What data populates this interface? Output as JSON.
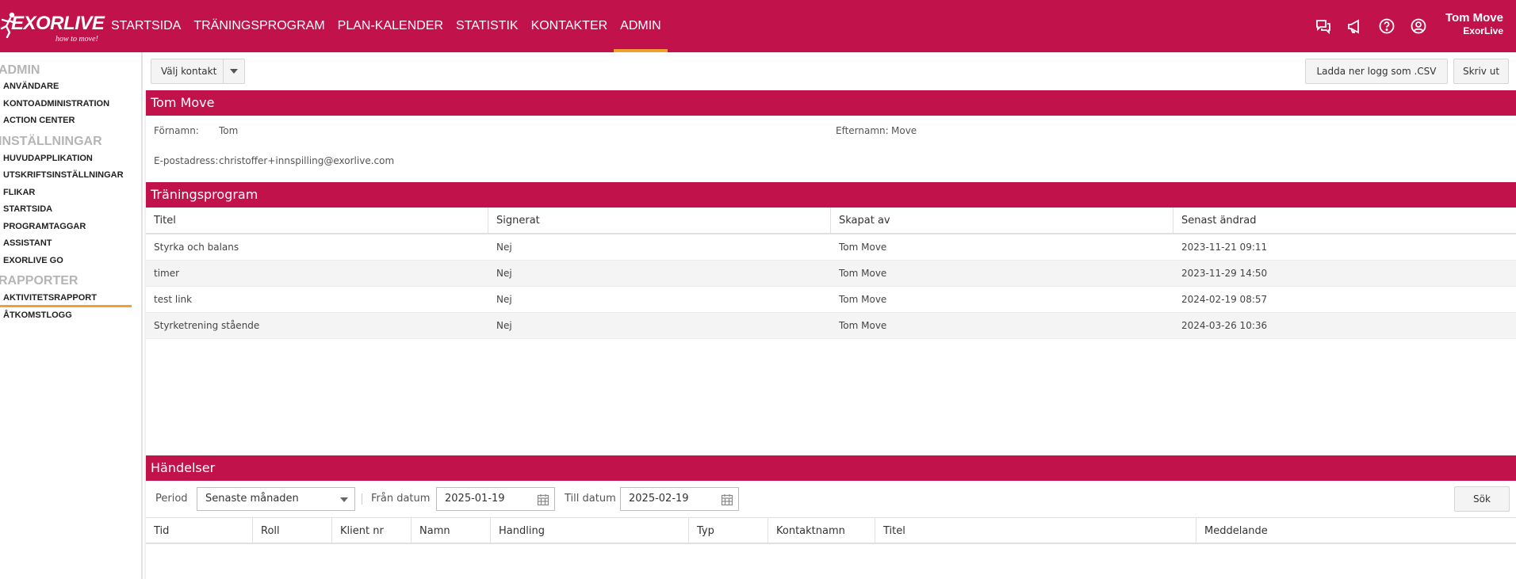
{
  "app": {
    "logo_text": "EXORLIVE",
    "logo_tagline": "how to move!"
  },
  "nav": {
    "items": [
      {
        "label": "STARTSIDA"
      },
      {
        "label": "TRÄNINGSPROGRAM"
      },
      {
        "label": "PLAN-KALENDER"
      },
      {
        "label": "STATISTIK"
      },
      {
        "label": "KONTAKTER"
      },
      {
        "label": "ADMIN",
        "active": true
      }
    ]
  },
  "top_icons": [
    "chat-icon",
    "megaphone-icon",
    "help-icon",
    "account-icon"
  ],
  "user": {
    "name": "Tom Move",
    "org": "ExorLive"
  },
  "sidebar": {
    "groups": [
      {
        "title": "ADMIN",
        "items": [
          "ANVÄNDARE",
          "KONTOADMINISTRATION",
          "ACTION CENTER"
        ]
      },
      {
        "title": "INSTÄLLNINGAR",
        "items": [
          "HUVUDAPPLIKATION",
          "UTSKRIFTSINSTÄLLNINGAR",
          "FLIKAR",
          "STARTSIDA",
          "PROGRAMTAGGAR",
          "ASSISTANT",
          "EXORLIVE GO"
        ]
      },
      {
        "title": "RAPPORTER",
        "items": [
          "AKTIVITETSRAPPORT",
          "ÅTKOMSTLOGG"
        ]
      }
    ],
    "active_item": "AKTIVITETSRAPPORT"
  },
  "toolbar": {
    "select_contact": "Välj kontakt",
    "download_csv": "Ladda ner logg som .CSV",
    "print": "Skriv ut"
  },
  "contact": {
    "heading": "Tom Move",
    "first_name_label": "Förnamn:",
    "first_name": "Tom",
    "last_name_label": "Efternamn:",
    "last_name": "Move",
    "email_label": "E-postadress:",
    "email": "christoffer+innspilling@exorlive.com"
  },
  "programs": {
    "heading": "Träningsprogram",
    "columns": [
      "Titel",
      "Signerat",
      "Skapat av",
      "Senast ändrad"
    ],
    "rows": [
      [
        "Styrka och balans",
        "Nej",
        "Tom Move",
        "2023-11-21 09:11"
      ],
      [
        "timer",
        "Nej",
        "Tom Move",
        "2023-11-29 14:50"
      ],
      [
        "test link",
        "Nej",
        "Tom Move",
        "2024-02-19 08:57"
      ],
      [
        "Styrketrening stående",
        "Nej",
        "Tom Move",
        "2024-03-26 10:36"
      ]
    ]
  },
  "events": {
    "heading": "Händelser",
    "period_label": "Period",
    "period_value": "Senaste månaden",
    "from_label": "Från datum",
    "from_value": "2025-01-19",
    "to_label": "Till datum",
    "to_value": "2025-02-19",
    "search_label": "Sök",
    "columns": [
      "Tid",
      "Roll",
      "Klient nr",
      "Namn",
      "Handling",
      "Typ",
      "Kontaktnamn",
      "Titel",
      "Meddelande"
    ]
  },
  "colors": {
    "brand": "#c2124b",
    "accent": "#f0a030"
  }
}
